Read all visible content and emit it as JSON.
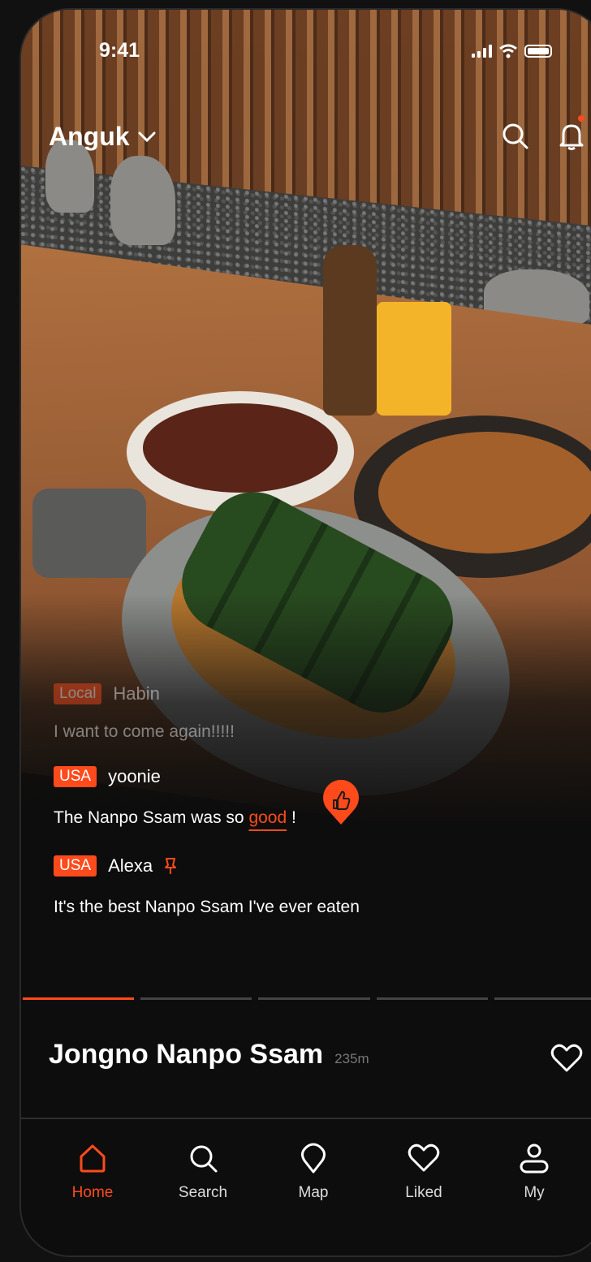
{
  "status_bar": {
    "time": "9:41"
  },
  "header": {
    "location": "Anguk"
  },
  "comments": [
    {
      "tag": "Local",
      "user": "Habin",
      "text": "I want to come again!!!!!",
      "faded": true
    },
    {
      "tag": "USA",
      "user": "yoonie",
      "text_before": "The Nanpo Ssam was so ",
      "highlight": "good",
      "text_after": " !"
    },
    {
      "tag": "USA",
      "user": "Alexa",
      "text": "It's the best Nanpo Ssam I've ever eaten",
      "pinned": true
    }
  ],
  "story_progress": {
    "segments": 5,
    "active_index": 0
  },
  "place": {
    "name": "Jongno Nanpo Ssam",
    "distance": "235m"
  },
  "nav": [
    {
      "label": "Home",
      "icon": "home-icon",
      "active": true
    },
    {
      "label": "Search",
      "icon": "search-icon",
      "active": false
    },
    {
      "label": "Map",
      "icon": "map-pin-icon",
      "active": false
    },
    {
      "label": "Liked",
      "icon": "heart-icon",
      "active": false
    },
    {
      "label": "My",
      "icon": "user-icon",
      "active": false
    }
  ],
  "colors": {
    "accent": "#ff4a1c",
    "background": "#0d0d0d"
  }
}
